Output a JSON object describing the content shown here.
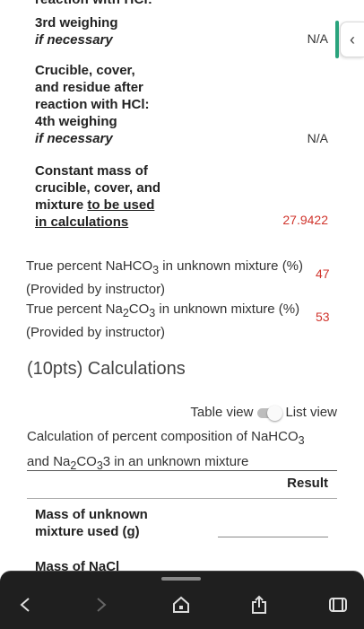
{
  "rows": [
    {
      "lines": [
        "3rd weighing"
      ],
      "italic": "if necessary",
      "value": "N/A"
    },
    {
      "lines": [
        "Crucible, cover,",
        "and residue after",
        "reaction with HCl:",
        "4th weighing"
      ],
      "italic": "if necessary",
      "value": "N/A"
    },
    {
      "lines": [
        "Constant mass of",
        "crucible, cover, and"
      ],
      "line3_prefix": "mixture ",
      "line3_underline": "to be used",
      "line4_underline": "in calculations",
      "value": "27.9422"
    }
  ],
  "cut_top_text": "reaction with HCl:",
  "info": [
    {
      "text": "True percent NaHCO",
      "sub": "3",
      "rest": " in unknown mixture (%)",
      "note": "(Provided by instructor)",
      "value": "47"
    },
    {
      "text": "True percent Na",
      "sub": "2",
      "mid": "CO",
      "sub2": "3",
      "rest": " in unknown mixture (%)",
      "note": "(Provided by instructor)",
      "value": "53"
    }
  ],
  "section_title": "(10pts) Calculations",
  "toggle": {
    "left": "Table view",
    "right": "List view"
  },
  "caption": {
    "part1": "Calculation of percent composition of NaHCO",
    "sub1": "3",
    "part2": "and Na",
    "sub2": "2",
    "part3": "CO",
    "sub3": "3",
    "part4": "3 in an unknown mixture"
  },
  "result_header": "Result",
  "calc_rows": [
    {
      "label_lines": [
        "Mass of unknown",
        "mixture used (g)"
      ]
    },
    {
      "label_lines": [
        "Mass of NaCl"
      ]
    }
  ],
  "colors": {
    "accent_red": "#d0342c",
    "side_tab_green": "#29a37c",
    "nav_bg": "#1f1f1f"
  }
}
